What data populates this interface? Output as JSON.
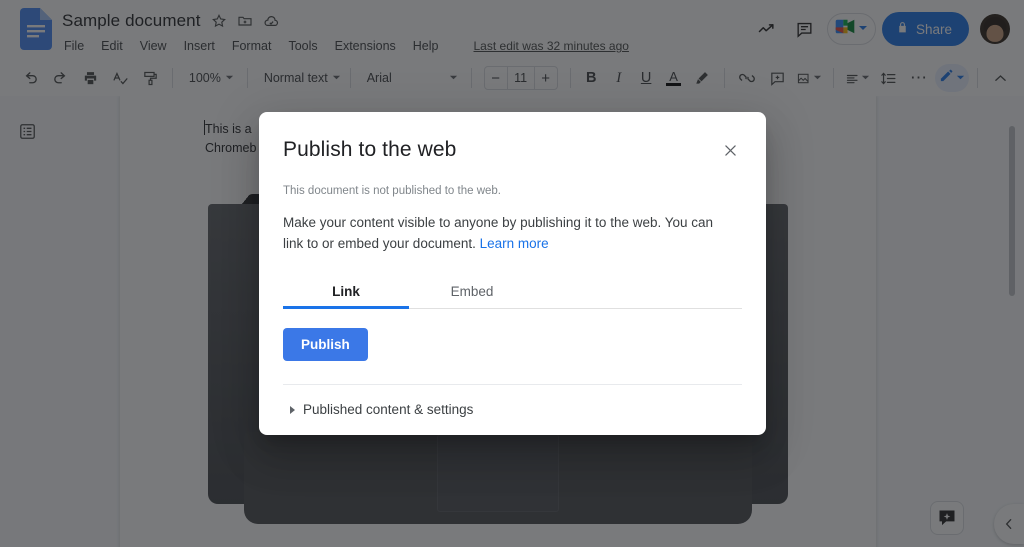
{
  "header": {
    "doc_title": "Sample document",
    "title_icons": [
      {
        "name": "star-icon",
        "glyph": "☆"
      },
      {
        "name": "move-to-folder-icon",
        "glyph": "folder-move"
      },
      {
        "name": "saved-to-drive-icon",
        "glyph": "cloud-check"
      }
    ],
    "menus": [
      "File",
      "Edit",
      "View",
      "Insert",
      "Format",
      "Tools",
      "Extensions",
      "Help"
    ],
    "last_edit": "Last edit was 32 minutes ago",
    "activity_icon": "trending-up-icon",
    "comment_history_icon": "comment-history-icon",
    "meet_icon": "google-meet-icon",
    "share_label": "Share",
    "share_lock_icon": "lock-icon",
    "avatar": "user-avatar"
  },
  "toolbar": {
    "undo": "undo-icon",
    "redo": "redo-icon",
    "print": "print-icon",
    "spellcheck": "spellcheck-icon",
    "paint_format": "paint-format-icon",
    "zoom_value": "100%",
    "style_value": "Normal text",
    "font_value": "Arial",
    "font_size_decrease": "−",
    "font_size_value": "11",
    "font_size_increase": "+",
    "bold": "B",
    "italic": "I",
    "underline": "U",
    "text_color": "A",
    "highlight": "highlight-pen-icon",
    "insert_link": "link-icon",
    "add_comment": "add-comment-icon",
    "insert_image": "insert-image-icon",
    "align": "align-left-icon",
    "line_spacing": "line-spacing-icon",
    "more_options": "⋯",
    "editing_mode": "pencil-icon",
    "collapse_toolbar": "chevron-up-icon"
  },
  "canvas": {
    "outline_button": "document-outline-icon",
    "document_text": "This is a\nChromeb",
    "ai_button": "gemini-sparkle-icon",
    "side_panel_expand": "chevron-left-icon"
  },
  "dialog": {
    "title": "Publish to the web",
    "close_icon": "close-icon",
    "status_note": "This document is not published to the web.",
    "body_text": "Make your content visible to anyone by publishing it to the web. You can link to or embed your document. ",
    "learn_more": "Learn more",
    "tabs": [
      {
        "label": "Link",
        "active": true
      },
      {
        "label": "Embed",
        "active": false
      }
    ],
    "publish_label": "Publish",
    "expander_label": "Published content & settings"
  },
  "colors": {
    "brand_blue": "#1a73e8",
    "publish_blue": "#3b78e7",
    "link_blue": "#1a73e8",
    "scrim": "rgba(32,33,36,.60)"
  }
}
